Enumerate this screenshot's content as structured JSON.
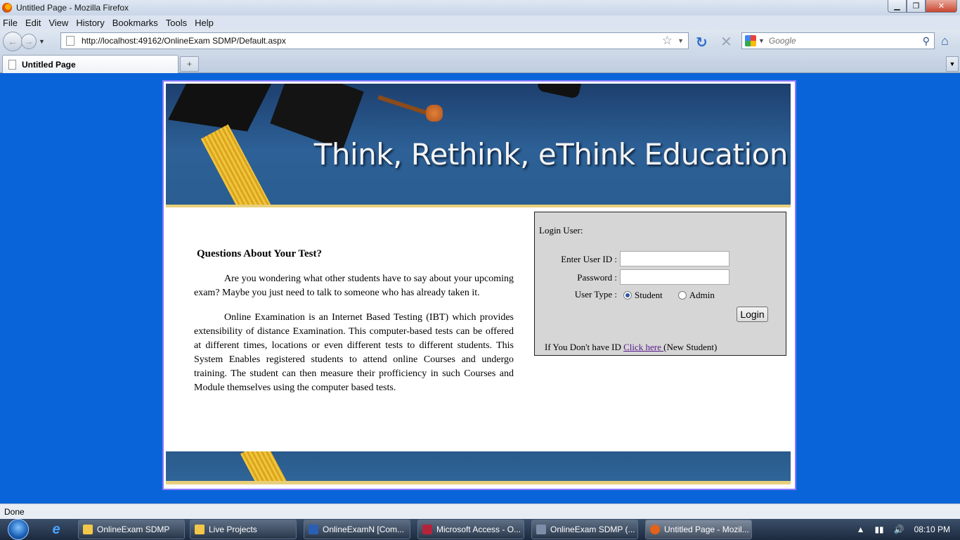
{
  "window": {
    "title": "Untitled Page - Mozilla Firefox",
    "minimize": "▁",
    "maximize": "❐",
    "close": "✕"
  },
  "menu": [
    "File",
    "Edit",
    "View",
    "History",
    "Bookmarks",
    "Tools",
    "Help"
  ],
  "nav": {
    "url": "http://localhost:49162/OnlineExam SDMP/Default.aspx",
    "search_placeholder": "Google"
  },
  "tabs": [
    {
      "label": "Untitled Page"
    }
  ],
  "page": {
    "banner_slogan": "Think, Rethink, eThink Education",
    "heading": "Questions About Your Test?",
    "paragraphs": [
      "Are you wondering what other students have to say about your upcoming exam? Maybe you just need to talk to someone who has already taken it.",
      "Online Examination is an Internet Based Testing (IBT) which provides extensibility of distance Examination. This computer-based tests can be offered at different times, locations or even different tests to different students. This System Enables registered students to attend online Courses and undergo training. The student can then measure their profficiency in such Courses and Module themselves using the computer based tests."
    ],
    "login": {
      "title": "Login User:",
      "user_id_label": "Enter User ID :",
      "password_label": "Password :",
      "user_type_label": "User Type :",
      "user_id_value": "",
      "password_value": "",
      "options": [
        "Student",
        "Admin"
      ],
      "selected_option": "Student",
      "button": "Login",
      "new_user_prefix": "If You Don't have ID ",
      "new_user_link": "Click here ",
      "new_user_suffix": "(New Student)"
    }
  },
  "status": "Done",
  "taskbar": {
    "items": [
      {
        "label": "OnlineExam SDMP",
        "icon_color": "#f3c74a"
      },
      {
        "label": "Live Projects",
        "icon_color": "#f3c74a"
      },
      {
        "label": "OnlineExamN [Com...",
        "icon_color": "#2b5fb3"
      },
      {
        "label": "Microsoft Access - O...",
        "icon_color": "#b3243a"
      },
      {
        "label": "OnlineExam SDMP (...",
        "icon_color": "#7d8fa8"
      },
      {
        "label": "Untitled Page - Mozil...",
        "icon_color": "#e2621b"
      }
    ],
    "clock": "08:10 PM"
  },
  "colors": {
    "page_background": "#0a64d9",
    "banner": "#2d6197",
    "gold_stripe": "#e8cf7a",
    "login_panel": "#d6d6d6"
  }
}
